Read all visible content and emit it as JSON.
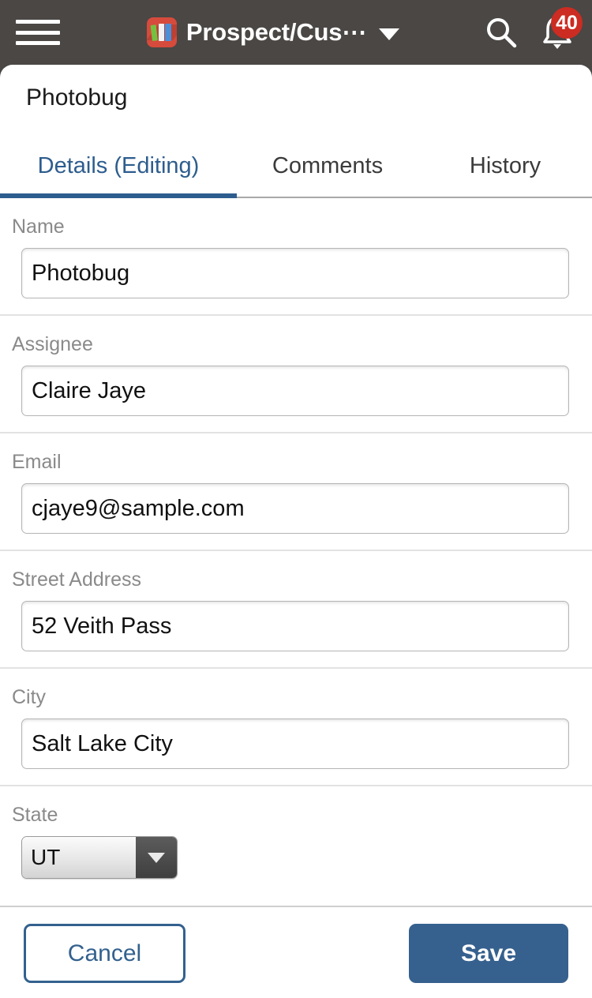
{
  "appbar": {
    "menu_icon": "hamburger-menu-icon",
    "app_icon": "binders-app-icon",
    "title": "Prospect/Cus⋯",
    "dropdown_icon": "chevron-down-icon",
    "search_icon": "search-icon",
    "bell_icon": "bell-icon",
    "notification_count": "40",
    "bg_color": "#4a4745",
    "badge_color": "#cc2c22"
  },
  "record": {
    "title": "Photobug"
  },
  "tabs": [
    {
      "label": "Details (Editing)",
      "active": true
    },
    {
      "label": "Comments",
      "active": false
    },
    {
      "label": "History",
      "active": false
    }
  ],
  "accent_color": "#2d5d8e",
  "fields": [
    {
      "label": "Name",
      "value": "Photobug",
      "type": "text"
    },
    {
      "label": "Assignee",
      "value": "Claire Jaye",
      "type": "text"
    },
    {
      "label": "Email",
      "value": "cjaye9@sample.com",
      "type": "text"
    },
    {
      "label": "Street Address",
      "value": "52 Veith Pass",
      "type": "text"
    },
    {
      "label": "City",
      "value": "Salt Lake City",
      "type": "text"
    },
    {
      "label": "State",
      "value": "UT",
      "type": "select"
    }
  ],
  "footer": {
    "cancel_label": "Cancel",
    "save_label": "Save",
    "cancel_color": "#33618e",
    "save_color": "#36618e"
  }
}
